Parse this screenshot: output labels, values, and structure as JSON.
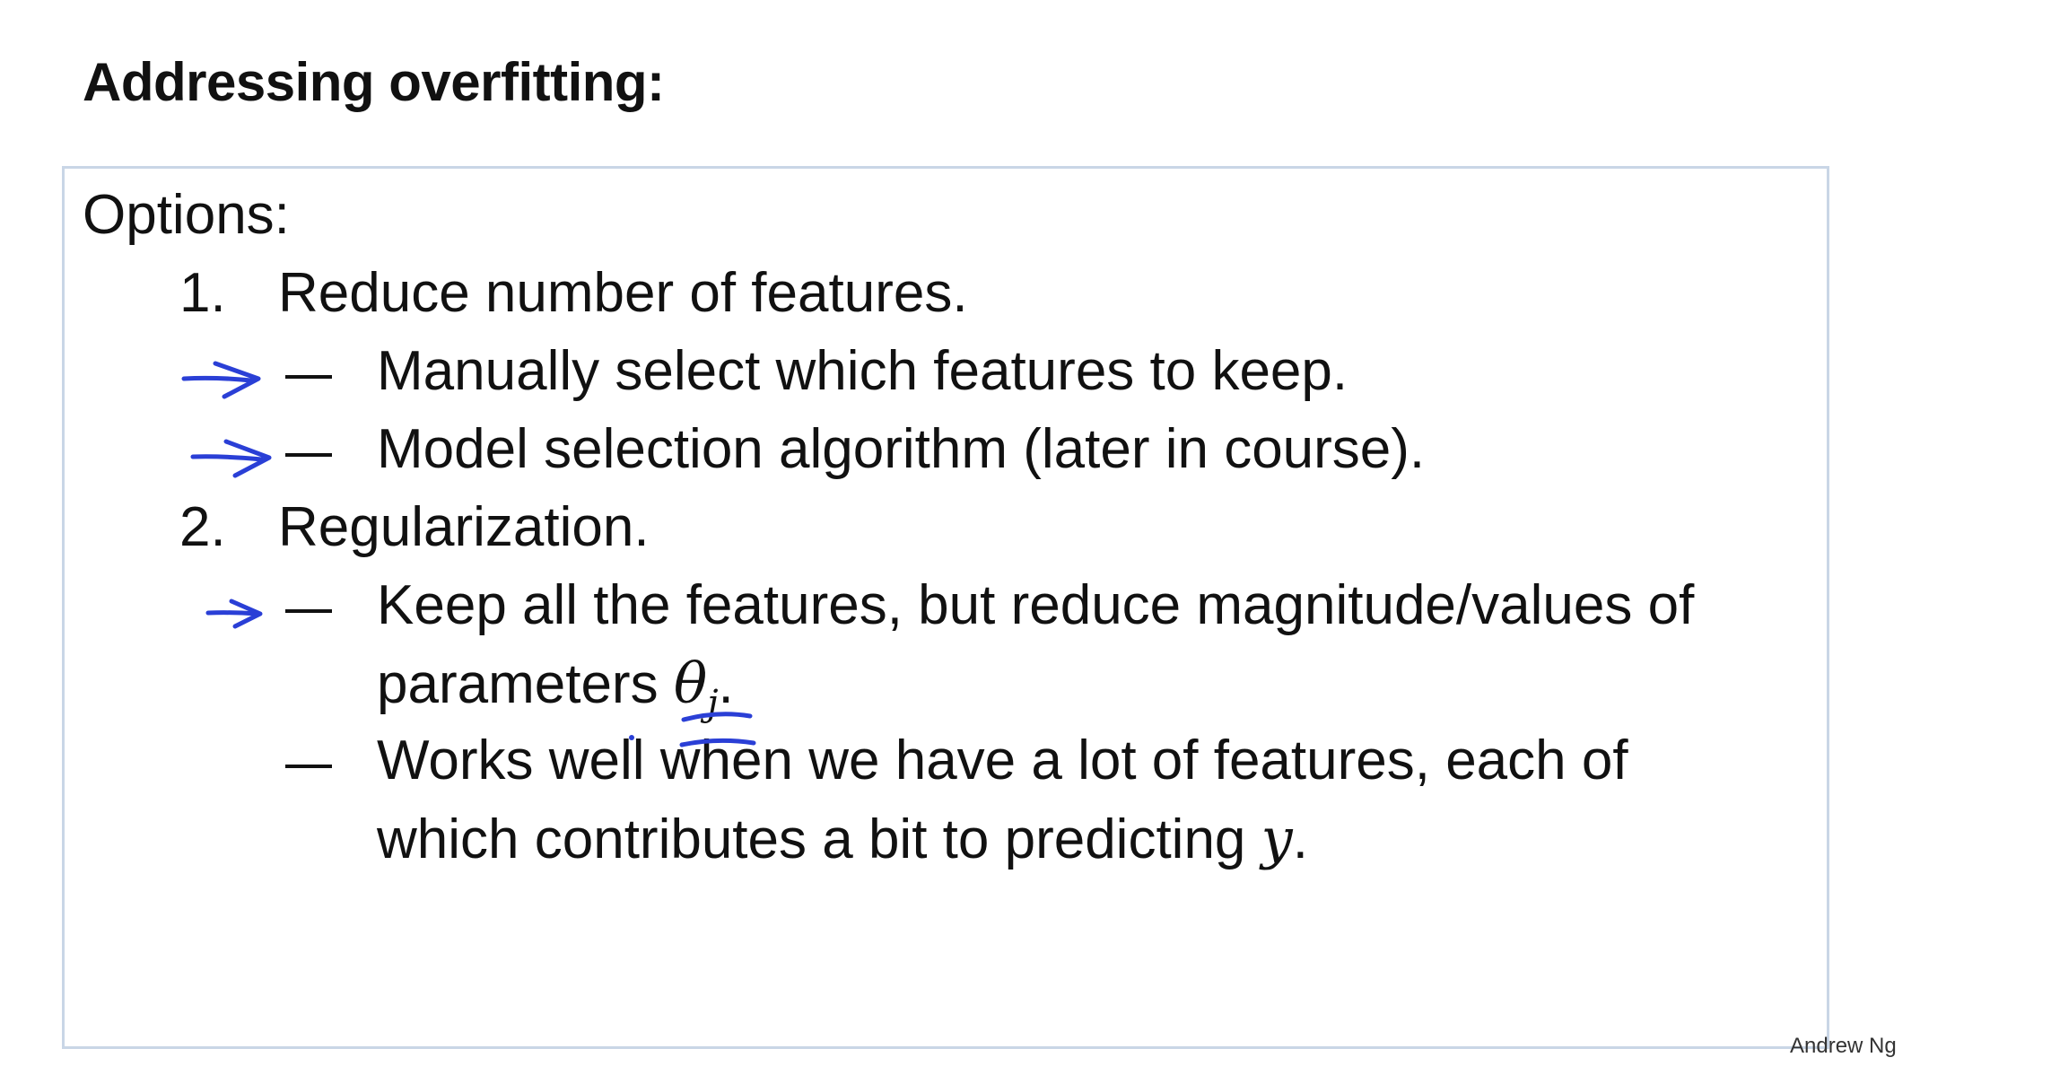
{
  "slide": {
    "title": "Addressing overfitting:",
    "options_label": "Options:",
    "items": [
      {
        "number": "1.",
        "text": "Reduce number of features.",
        "sub": [
          "Manually select which features to keep.",
          "Model selection algorithm (later in course)."
        ]
      },
      {
        "number": "2.",
        "text": "Regularization.",
        "sub": [
          {
            "line1": "Keep all the features, but reduce magnitude/values of",
            "line2_prefix": "parameters ",
            "symbol": "θ",
            "subscript": "j",
            "line2_suffix": "."
          },
          {
            "line1": "Works well when we have a lot of features, each of",
            "line2_prefix": "which contributes a bit to predicting ",
            "symbol": "y",
            "line2_suffix": "."
          }
        ]
      }
    ],
    "author": "Andrew Ng"
  },
  "annotations": {
    "ink_color": "#2a3fd6"
  }
}
